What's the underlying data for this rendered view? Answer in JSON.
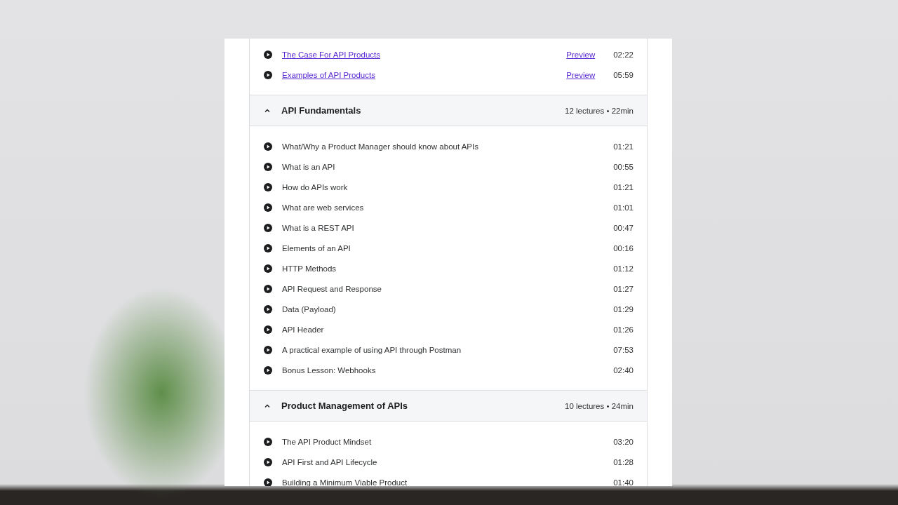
{
  "sections": [
    {
      "lectures": [
        {
          "title": "The Case For API Products",
          "preview": "Preview",
          "duration": "02:22"
        },
        {
          "title": "Examples of API Products",
          "preview": "Preview",
          "duration": "05:59"
        }
      ]
    },
    {
      "header": {
        "title": "API Fundamentals",
        "summary": "12 lectures • 22min",
        "expanded": true
      },
      "lectures": [
        {
          "title": "What/Why a Product Manager should know about APIs",
          "duration": "01:21"
        },
        {
          "title": "What is an API",
          "duration": "00:55"
        },
        {
          "title": "How do APIs work",
          "duration": "01:21"
        },
        {
          "title": "What are web services",
          "duration": "01:01"
        },
        {
          "title": "What is a REST API",
          "duration": "00:47"
        },
        {
          "title": "Elements of an API",
          "duration": "00:16"
        },
        {
          "title": "HTTP Methods",
          "duration": "01:12"
        },
        {
          "title": "API Request and Response",
          "duration": "01:27"
        },
        {
          "title": "Data (Payload)",
          "duration": "01:29"
        },
        {
          "title": "API Header",
          "duration": "01:26"
        },
        {
          "title": "A practical example of using API through Postman",
          "duration": "07:53"
        },
        {
          "title": "Bonus Lesson: Webhooks",
          "duration": "02:40"
        }
      ]
    },
    {
      "header": {
        "title": "Product Management of APIs",
        "summary": "10 lectures • 24min",
        "expanded": true
      },
      "lectures": [
        {
          "title": "The API Product Mindset",
          "duration": "03:20"
        },
        {
          "title": "API First and API Lifecycle",
          "duration": "01:28"
        },
        {
          "title": "Building a Minimum Viable Product",
          "duration": "01:40"
        }
      ]
    }
  ]
}
